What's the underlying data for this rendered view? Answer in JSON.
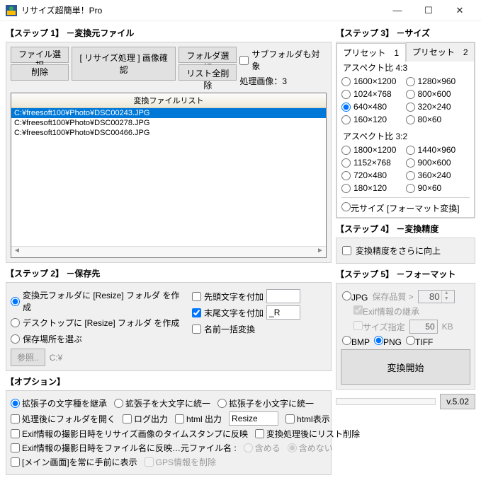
{
  "title": "リサイズ超簡単！Pro",
  "step1": {
    "title": "【ステップ 1】 －変換元ファイル",
    "btnFile": "ファイル選択",
    "btnDelete": "削除",
    "btnFolder": "フォルダ選択",
    "btnClear": "リスト全削除",
    "btnProcess": "[ リサイズ処理 ] 画像確認",
    "chkSub": "サブフォルダも対象",
    "countLabel": "処理画像：3",
    "listHeader": "変換ファイルリスト",
    "files": [
      "C:¥freesoft100¥Photo¥DSC00243.JPG",
      "C:¥freesoft100¥Photo¥DSC00278.JPG",
      "C:¥freesoft100¥Photo¥DSC00466.JPG"
    ]
  },
  "step2": {
    "title": "【ステップ 2】 －保存先",
    "opt1": "変換元フォルダに [Resize] フォルダ を作成",
    "opt2": "デスクトップに [Resize] フォルダ を作成",
    "opt3": "保存場所を選ぶ",
    "btnRef": "参照..",
    "path": "C:¥",
    "chkPre": "先頭文字を付加",
    "chkSuf": "末尾文字を付加",
    "sufVal": "_R",
    "chkRen": "名前一括変換"
  },
  "options": {
    "title": "【オプション】",
    "extInherit": "拡張子の文字種を継承",
    "extUpper": "拡張子を大文字に統一",
    "extLower": "拡張子を小文字に統一",
    "openFolder": "処理後にフォルダを開く",
    "logOut": "ログ出力",
    "htmlOut": "html 出力",
    "htmlInp": "Resize",
    "htmlShow": "html表示",
    "exifTs": "Exif情報の撮影日時をリサイズ画像のタイムスタンプに反映",
    "delAfter": "変換処理後にリスト削除",
    "exifFile": "Exif情報の撮影日時をファイル名に反映…元ファイル名  :",
    "include": "含める",
    "exclude": "含めない",
    "alwaysFront": "[メイン画面]を常に手前に表示",
    "delGps": "GPS情報を削除"
  },
  "step3": {
    "title": "【ステップ 3】 －サイズ",
    "tab1": "プリセット　1",
    "tab2": "プリセット　2",
    "asp43": "アスペクト比 4:3",
    "asp32": "アスペクト比 3:2",
    "sizes43": [
      "1600×1200",
      "1280×960",
      "1024×768",
      "800×600",
      "640×480",
      "320×240",
      "160×120",
      "80×60"
    ],
    "sizes32": [
      "1800×1200",
      "1440×960",
      "1152×768",
      "900×600",
      "720×480",
      "360×240",
      "180×120",
      "90×60"
    ],
    "originalLabel": "元サイズ  [フォーマット変換]"
  },
  "step4": {
    "title": "【ステップ 4】 －変換精度",
    "opt": "変換精度をさらに向上"
  },
  "step5": {
    "title": "【ステップ 5】 －フォーマット",
    "jpg": "JPG",
    "qual": "保存品質 >",
    "qualVal": "80",
    "exif": "Exif情報の継承",
    "sizeSpec": "サイズ指定",
    "sizeVal": "50",
    "kb": "KB",
    "bmp": "BMP",
    "png": "PNG",
    "tiff": "TIFF",
    "start": "変換開始"
  },
  "version": "v.5.02"
}
